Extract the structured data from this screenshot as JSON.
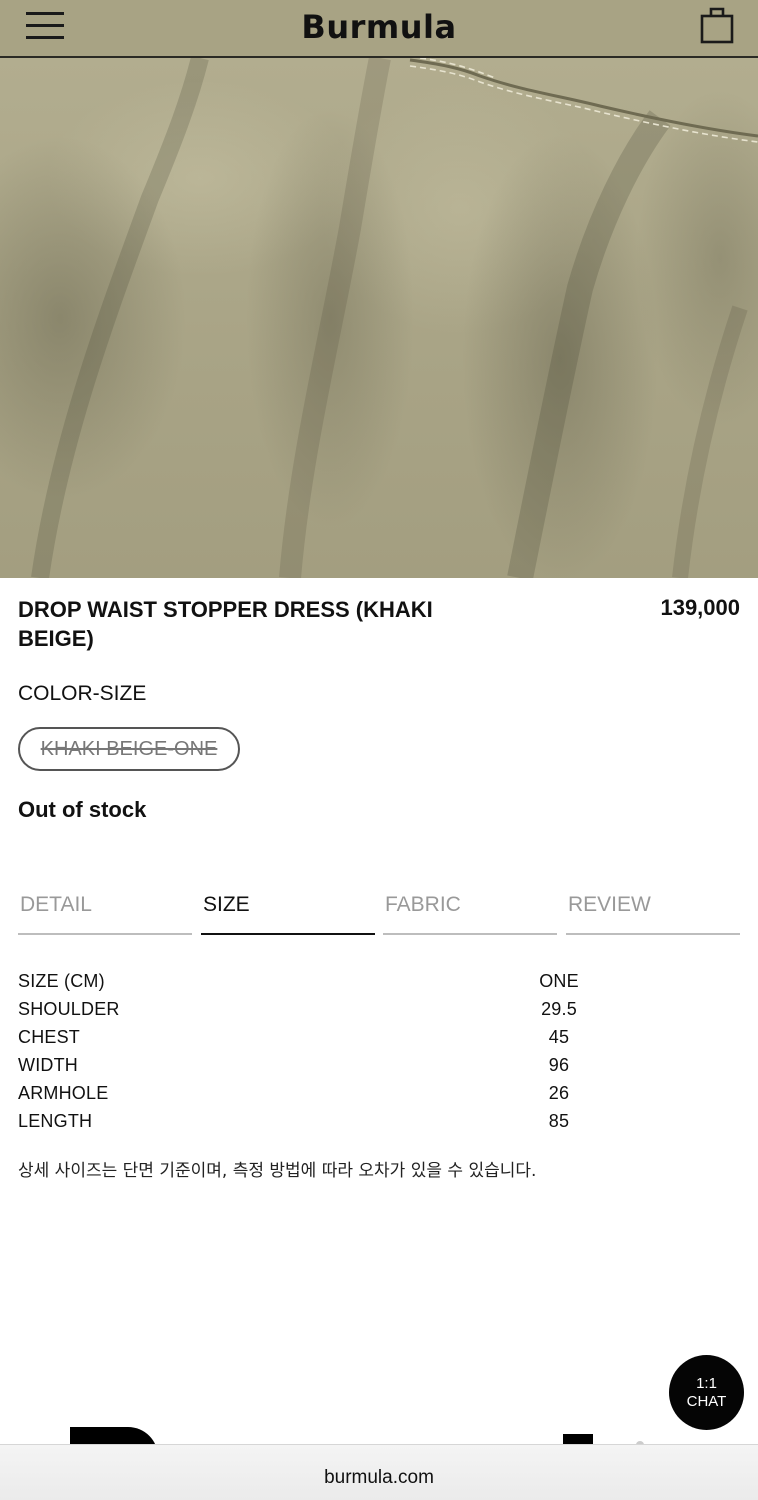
{
  "header": {
    "brand": "Burmula",
    "menu_icon": "hamburger-menu-icon",
    "bag_icon": "shopping-bag-icon",
    "background_color": "#a8a384"
  },
  "product": {
    "title": "DROP WAIST STOPPER DRESS (KHAKI BEIGE)",
    "price": "139,000",
    "option_label": "COLOR-SIZE",
    "option_value": "KHAKI BEIGE-ONE",
    "stock_status": "Out of stock"
  },
  "tabs": [
    {
      "label": "DETAIL",
      "active": false
    },
    {
      "label": "SIZE",
      "active": true
    },
    {
      "label": "FABRIC",
      "active": false
    },
    {
      "label": "REVIEW",
      "active": false
    }
  ],
  "size_table": [
    {
      "label": "SIZE (CM)",
      "value": "ONE"
    },
    {
      "label": "SHOULDER",
      "value": "29.5"
    },
    {
      "label": "CHEST",
      "value": "45"
    },
    {
      "label": "WIDTH",
      "value": "96"
    },
    {
      "label": "ARMHOLE",
      "value": "26"
    },
    {
      "label": "LENGTH",
      "value": "85"
    }
  ],
  "size_note": "상세 사이즈는 단면 기준이며, 측정 방법에 따라 오차가 있을 수 있습니다.",
  "chat": {
    "line1": "1:1",
    "line2": "CHAT"
  },
  "browser": {
    "url": "burmula.com"
  }
}
